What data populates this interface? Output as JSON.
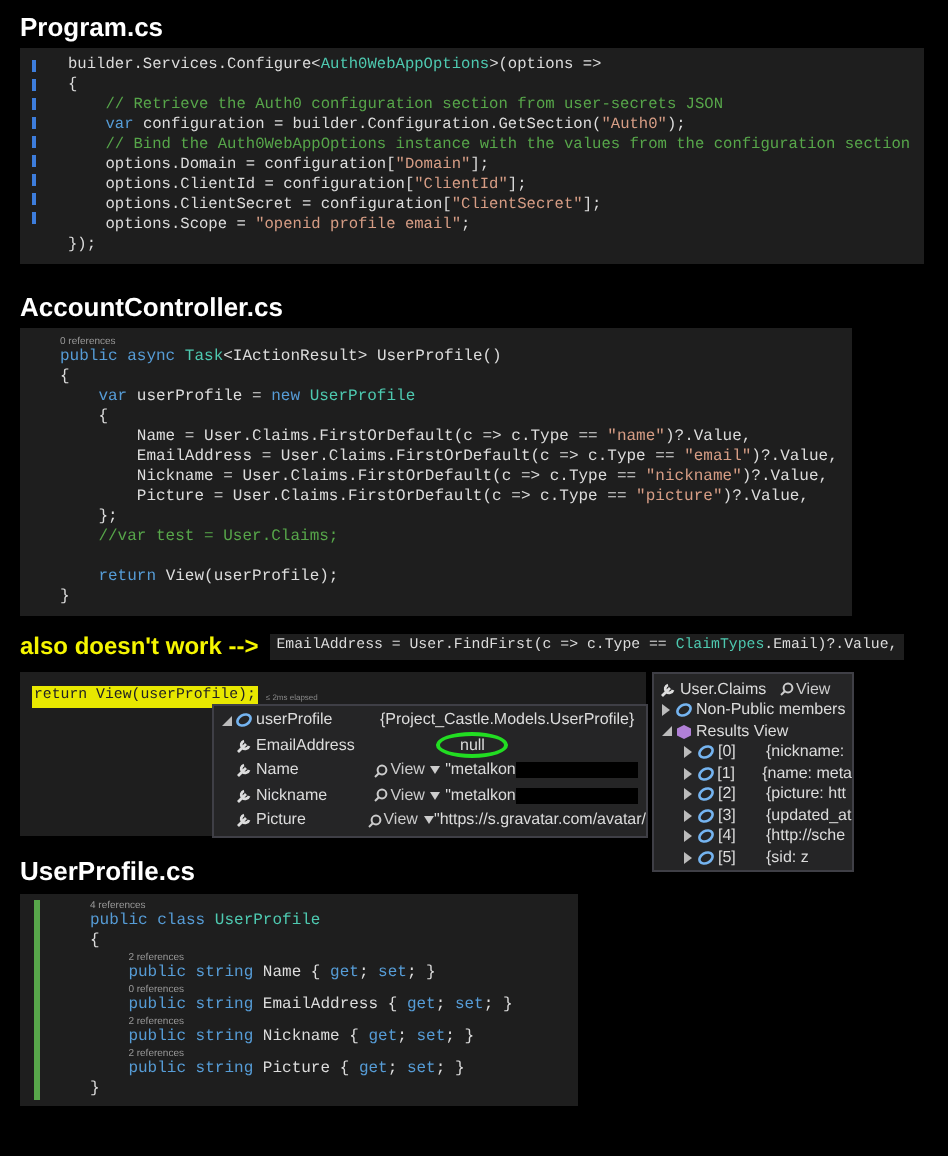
{
  "sections": [
    {
      "heading": "Program.cs",
      "kind": "program",
      "lines": [
        {
          "kind": "code",
          "tokens": [
            {
              "kind": "plain",
              "text": "builder.Services.Configure<"
            },
            {
              "kind": "type",
              "text": "Auth0WebAppOptions"
            },
            {
              "kind": "plain",
              "text": ">(options =>"
            }
          ]
        },
        {
          "kind": "code",
          "tokens": [
            {
              "kind": "plain",
              "text": "{"
            }
          ]
        },
        {
          "kind": "code",
          "tokens": [
            {
              "kind": "cmt",
              "text": "    // Retrieve the Auth0 configuration section from user-secrets JSON"
            }
          ]
        },
        {
          "kind": "code",
          "tokens": [
            {
              "kind": "kw",
              "text": "    var"
            },
            {
              "kind": "plain",
              "text": " configuration = builder.Configuration.GetSection("
            },
            {
              "kind": "str",
              "text": "\"Auth0\""
            },
            {
              "kind": "plain",
              "text": ");"
            }
          ]
        },
        {
          "kind": "code",
          "tokens": [
            {
              "kind": "cmt",
              "text": "    // Bind the Auth0WebAppOptions instance with the values from the configuration section"
            }
          ]
        },
        {
          "kind": "code",
          "tokens": [
            {
              "kind": "plain",
              "text": "    options.Domain = configuration["
            },
            {
              "kind": "str",
              "text": "\"Domain\""
            },
            {
              "kind": "plain",
              "text": "];"
            }
          ]
        },
        {
          "kind": "code",
          "tokens": [
            {
              "kind": "plain",
              "text": "    options.ClientId = configuration["
            },
            {
              "kind": "str",
              "text": "\"ClientId\""
            },
            {
              "kind": "plain",
              "text": "];"
            }
          ]
        },
        {
          "kind": "code",
          "tokens": [
            {
              "kind": "plain",
              "text": "    options.ClientSecret = configuration["
            },
            {
              "kind": "str",
              "text": "\"ClientSecret\""
            },
            {
              "kind": "plain",
              "text": "];"
            }
          ]
        },
        {
          "kind": "code",
          "tokens": [
            {
              "kind": "plain",
              "text": "    options.Scope = "
            },
            {
              "kind": "str",
              "text": "\"openid profile email\""
            },
            {
              "kind": "plain",
              "text": ";"
            }
          ]
        },
        {
          "kind": "code",
          "tokens": [
            {
              "kind": "plain",
              "text": "});"
            }
          ]
        }
      ]
    },
    {
      "heading": "AccountController.cs",
      "kind": "controller",
      "lines": [
        {
          "kind": "refs",
          "text": "0 references"
        },
        {
          "kind": "code",
          "tokens": [
            {
              "kind": "kw",
              "text": "public async "
            },
            {
              "kind": "type",
              "text": "Task"
            },
            {
              "kind": "plain",
              "text": "<IActionResult> UserProfile()"
            }
          ]
        },
        {
          "kind": "code",
          "tokens": [
            {
              "kind": "plain",
              "text": "{"
            }
          ]
        },
        {
          "kind": "code",
          "tokens": [
            {
              "kind": "kw",
              "text": "    var"
            },
            {
              "kind": "plain",
              "text": " userProfile = "
            },
            {
              "kind": "kw",
              "text": "new "
            },
            {
              "kind": "type",
              "text": "UserProfile"
            }
          ]
        },
        {
          "kind": "code",
          "tokens": [
            {
              "kind": "plain",
              "text": "    {"
            }
          ]
        },
        {
          "kind": "code",
          "tokens": [
            {
              "kind": "plain",
              "text": "        Name = User.Claims.FirstOrDefault(c => c.Type == "
            },
            {
              "kind": "str",
              "text": "\"name\""
            },
            {
              "kind": "plain",
              "text": ")?.Value,"
            }
          ]
        },
        {
          "kind": "code",
          "tokens": [
            {
              "kind": "plain",
              "text": "        EmailAddress = User.Claims.FirstOrDefault(c => c.Type == "
            },
            {
              "kind": "str",
              "text": "\"email\""
            },
            {
              "kind": "plain",
              "text": ")?.Value,"
            }
          ]
        },
        {
          "kind": "code",
          "tokens": [
            {
              "kind": "plain",
              "text": "        Nickname = User.Claims.FirstOrDefault(c => c.Type == "
            },
            {
              "kind": "str",
              "text": "\"nickname\""
            },
            {
              "kind": "plain",
              "text": ")?.Value,"
            }
          ]
        },
        {
          "kind": "code",
          "tokens": [
            {
              "kind": "plain",
              "text": "        Picture = User.Claims.FirstOrDefault(c => c.Type == "
            },
            {
              "kind": "str",
              "text": "\"picture\""
            },
            {
              "kind": "plain",
              "text": ")?.Value,"
            }
          ]
        },
        {
          "kind": "code",
          "tokens": [
            {
              "kind": "plain",
              "text": "    };"
            }
          ]
        },
        {
          "kind": "code",
          "tokens": [
            {
              "kind": "cmt",
              "text": "    //var test = User.Claims;"
            }
          ]
        },
        {
          "kind": "blank"
        },
        {
          "kind": "code",
          "tokens": [
            {
              "kind": "kw",
              "text": "    return "
            },
            {
              "kind": "plain",
              "text": "View(userProfile);"
            }
          ]
        },
        {
          "kind": "code",
          "tokens": [
            {
              "kind": "plain",
              "text": "}"
            }
          ]
        }
      ]
    }
  ],
  "note": {
    "label": "also doesn't work -->",
    "tokens": [
      {
        "kind": "plain",
        "text": "EmailAddress = User.FindFirst(c => c.Type == "
      },
      {
        "kind": "type",
        "text": "ClaimTypes"
      },
      {
        "kind": "plain",
        "text": ".Email)?.Value,"
      }
    ]
  },
  "debugger": {
    "current_line": "return View(userProfile);",
    "elapsed": "≤ 2ms elapsed",
    "datatip": [
      {
        "kind": "object",
        "name": "userProfile",
        "value": "{Project_Castle.Models.UserProfile}",
        "circled": false,
        "redacted": false
      },
      {
        "kind": "property",
        "name": "EmailAddress",
        "value": "null",
        "circled": true,
        "redacted": false
      },
      {
        "kind": "property",
        "name": "Name",
        "view": "View",
        "value": "\"metalkon",
        "circled": false,
        "redacted": true
      },
      {
        "kind": "property",
        "name": "Nickname",
        "view": "View",
        "value": "\"metalkon",
        "circled": false,
        "redacted": true
      },
      {
        "kind": "property",
        "name": "Picture",
        "view": "View",
        "value": "\"https://s.gravatar.com/avatar/",
        "circled": false,
        "redacted": false
      }
    ]
  },
  "claims": {
    "title": "User.Claims",
    "view": "View",
    "items": [
      {
        "label": "Non-Public members",
        "expanded": false
      },
      {
        "label": "Results View",
        "expanded": true,
        "children": [
          {
            "label": "[0]",
            "value": "{nickname:"
          },
          {
            "label": "[1]",
            "value": "{name: meta"
          },
          {
            "label": "[2]",
            "value": "{picture: htt"
          },
          {
            "label": "[3]",
            "value": "{updated_at"
          },
          {
            "label": "[4]",
            "value": "{http://sche"
          },
          {
            "label": "[5]",
            "value": "{sid: z"
          }
        ]
      }
    ]
  },
  "user_profile": {
    "heading": "UserProfile.cs",
    "lines": [
      {
        "kind": "refs",
        "text": "4 references"
      },
      {
        "kind": "code",
        "tokens": [
          {
            "kind": "kw",
            "text": "public class "
          },
          {
            "kind": "type",
            "text": "UserProfile"
          }
        ]
      },
      {
        "kind": "code",
        "tokens": [
          {
            "kind": "plain",
            "text": "{"
          }
        ]
      },
      {
        "kind": "refs",
        "text": "2 references"
      },
      {
        "kind": "code",
        "tokens": [
          {
            "kind": "kw",
            "text": "    public string "
          },
          {
            "kind": "plain",
            "text": "Name { "
          },
          {
            "kind": "kw",
            "text": "get"
          },
          {
            "kind": "plain",
            "text": "; "
          },
          {
            "kind": "kw",
            "text": "set"
          },
          {
            "kind": "plain",
            "text": "; }"
          }
        ]
      },
      {
        "kind": "refs",
        "text": "0 references"
      },
      {
        "kind": "code",
        "tokens": [
          {
            "kind": "kw",
            "text": "    public string "
          },
          {
            "kind": "plain",
            "text": "EmailAddress { "
          },
          {
            "kind": "kw",
            "text": "get"
          },
          {
            "kind": "plain",
            "text": "; "
          },
          {
            "kind": "kw",
            "text": "set"
          },
          {
            "kind": "plain",
            "text": "; }"
          }
        ]
      },
      {
        "kind": "refs",
        "text": "2 references"
      },
      {
        "kind": "code",
        "tokens": [
          {
            "kind": "kw",
            "text": "    public string "
          },
          {
            "kind": "plain",
            "text": "Nickname { "
          },
          {
            "kind": "kw",
            "text": "get"
          },
          {
            "kind": "plain",
            "text": "; "
          },
          {
            "kind": "kw",
            "text": "set"
          },
          {
            "kind": "plain",
            "text": "; }"
          }
        ]
      },
      {
        "kind": "refs",
        "text": "2 references"
      },
      {
        "kind": "code",
        "tokens": [
          {
            "kind": "kw",
            "text": "    public string "
          },
          {
            "kind": "plain",
            "text": "Picture { "
          },
          {
            "kind": "kw",
            "text": "get"
          },
          {
            "kind": "plain",
            "text": "; "
          },
          {
            "kind": "kw",
            "text": "set"
          },
          {
            "kind": "plain",
            "text": "; }"
          }
        ]
      },
      {
        "kind": "code",
        "tokens": [
          {
            "kind": "plain",
            "text": "}"
          }
        ]
      }
    ]
  }
}
